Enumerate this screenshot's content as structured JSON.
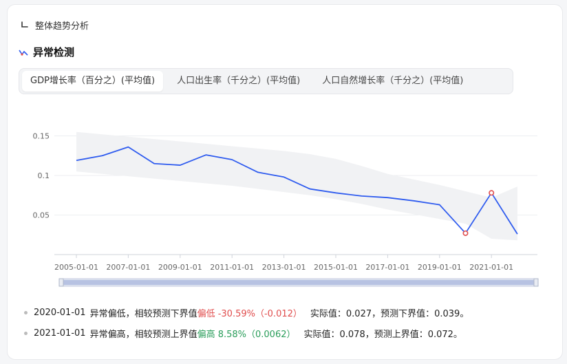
{
  "breadcrumb": {
    "label": "整体趋势分析"
  },
  "section": {
    "title": "异常检测"
  },
  "tabs": [
    {
      "label": "GDP增长率（百分之）(平均值)",
      "active": true
    },
    {
      "label": "人口出生率（千分之）(平均值)",
      "active": false
    },
    {
      "label": "人口自然增长率（千分之）(平均值)",
      "active": false
    }
  ],
  "colors": {
    "line": "#2e5bef",
    "band": "#f1f2f4",
    "anomaly": "#e04c4c",
    "low": "#e04c4c",
    "high": "#2a9d5a"
  },
  "chart_data": {
    "type": "line",
    "x": [
      "2005-01-01",
      "2006-01-01",
      "2007-01-01",
      "2008-01-01",
      "2009-01-01",
      "2010-01-01",
      "2011-01-01",
      "2012-01-01",
      "2013-01-01",
      "2014-01-01",
      "2015-01-01",
      "2016-01-01",
      "2017-01-01",
      "2018-01-01",
      "2019-01-01",
      "2020-01-01",
      "2021-01-01",
      "2022-01-01"
    ],
    "x_tick_labels": [
      "2005-01-01",
      "2007-01-01",
      "2009-01-01",
      "2011-01-01",
      "2013-01-01",
      "2015-01-01",
      "2017-01-01",
      "2019-01-01",
      "2021-01-01"
    ],
    "series": [
      {
        "values": [
          0.119,
          0.125,
          0.136,
          0.115,
          0.113,
          0.126,
          0.12,
          0.104,
          0.098,
          0.083,
          0.078,
          0.074,
          0.072,
          0.068,
          0.063,
          0.027,
          0.078,
          0.026
        ]
      }
    ],
    "band_upper": [
      0.155,
      0.152,
      0.149,
      0.146,
      0.143,
      0.14,
      0.137,
      0.134,
      0.131,
      0.127,
      0.121,
      0.112,
      0.102,
      0.095,
      0.088,
      0.08,
      0.072,
      0.086
    ],
    "band_lower": [
      0.105,
      0.102,
      0.099,
      0.096,
      0.093,
      0.09,
      0.087,
      0.083,
      0.079,
      0.075,
      0.07,
      0.064,
      0.057,
      0.051,
      0.045,
      0.039,
      0.02,
      0.018
    ],
    "anomalies": [
      {
        "x": "2020-01-01",
        "y": 0.027
      },
      {
        "x": "2021-01-01",
        "y": 0.078
      }
    ],
    "y_ticks": [
      0.05,
      0.1,
      0.15
    ],
    "y_tick_labels": [
      "0.05",
      "0.1",
      "0.15"
    ],
    "ylim": [
      0,
      0.165
    ],
    "grid": true
  },
  "notes": [
    {
      "date": "2020-01-01",
      "text": "异常偏低，相较预测下界值",
      "tag": "偏低 -30.59%（-0.012）",
      "kind": "low",
      "detail": "实际值：0.027，预测下界值：0.039。"
    },
    {
      "date": "2021-01-01",
      "text": "异常偏高，相较预测上界值",
      "tag": "偏高 8.58%（0.0062）",
      "kind": "high",
      "detail": "实际值：0.078，预测上界值：0.072。"
    }
  ]
}
